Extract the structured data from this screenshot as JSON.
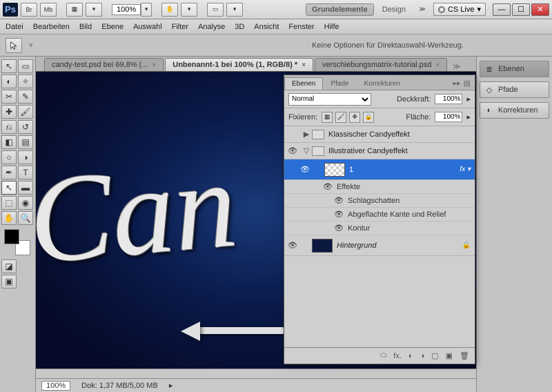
{
  "titlebar": {
    "zoom": "100%",
    "workspace": "Grundelemente",
    "design": "Design",
    "cslive": "CS Live"
  },
  "menu": {
    "datei": "Datei",
    "bearbeiten": "Bearbeiten",
    "bild": "Bild",
    "ebene": "Ebene",
    "auswahl": "Auswahl",
    "filter": "Filter",
    "analyse": "Analyse",
    "drei_d": "3D",
    "ansicht": "Ansicht",
    "fenster": "Fenster",
    "hilfe": "Hilfe"
  },
  "options": {
    "message": "Keine Optionen für Direktauswahl-Werkzeug."
  },
  "tabs": {
    "t1": "candy-test.psd bei 69,8% (...",
    "t2": "Unbenannt-1 bei 100% (1, RGB/8) *",
    "t3": "verschiebungsmatrix-tutorial.psd"
  },
  "canvas": {
    "text": "Can"
  },
  "status": {
    "zoom": "100%",
    "doc": "Dok: 1,37 MB/5,00 MB"
  },
  "right": {
    "ebenen": "Ebenen",
    "pfade": "Pfade",
    "korrekturen": "Korrekturen"
  },
  "layers": {
    "tabs": {
      "ebenen": "Ebenen",
      "pfade": "Pfade",
      "korrekturen": "Korrekturen"
    },
    "blend": "Normal",
    "opacity_label": "Deckkraft:",
    "opacity": "100%",
    "lock_label": "Fixieren:",
    "fill_label": "Fläche:",
    "fill": "100%",
    "group1": "Klassischer Candyeffekt",
    "group2": "Illustrativer Candyeffekt",
    "layer1": "1",
    "effekte": "Effekte",
    "fx1": "Schlagschatten",
    "fx2": "Abgeflachte Kante und Relief",
    "fx3": "Kontur",
    "bg": "Hintergrund"
  }
}
